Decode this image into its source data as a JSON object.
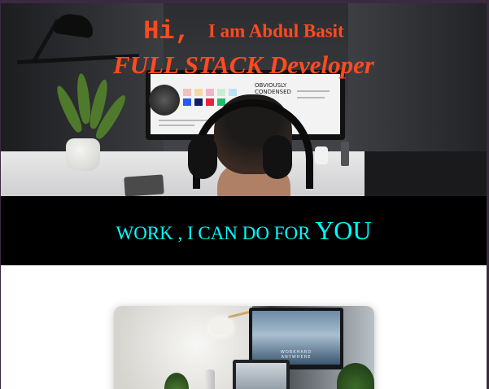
{
  "hero": {
    "greeting": "Hi,",
    "name": "I am Abdul Basit",
    "role": "FULL STACK Developer",
    "photo_description": "workspace-photo",
    "screen_text": "OBVIOUSLY CONDENSED"
  },
  "work": {
    "prefix": "WORK , I CAN DO FOR ",
    "emphasis": "YOU"
  },
  "project_card": {
    "screen_text": "WORKHARD ANYWHERE"
  },
  "colors": {
    "accent": "#ff4b1f",
    "banner_text": "#00ffff",
    "banner_bg": "#000000"
  }
}
